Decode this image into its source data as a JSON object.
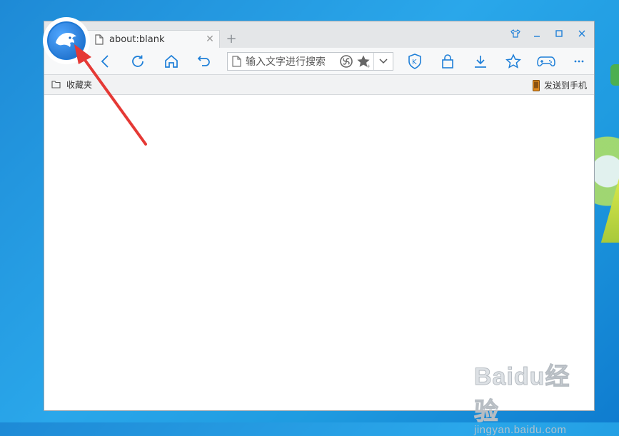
{
  "tab": {
    "title": "about:blank"
  },
  "address_bar": {
    "placeholder": "输入文字进行搜索"
  },
  "bookmarks_bar": {
    "favorites_label": "收藏夹",
    "send_to_phone_label": "发送到手机"
  },
  "watermark": {
    "main": "Baidu经验",
    "sub": "jingyan.baidu.com"
  },
  "colors": {
    "accent": "#1e7fd8",
    "annotation_arrow": "#e53935",
    "desktop_blue": "#2aa7ea"
  },
  "icons": {
    "toolbar": [
      "back-icon",
      "refresh-icon",
      "home-icon",
      "undo-icon",
      "shield-k-icon",
      "lock-icon",
      "download-icon",
      "star-icon",
      "gamepad-icon",
      "more-icon"
    ],
    "window": [
      "skin-icon",
      "minimize-icon",
      "maximize-icon",
      "close-icon"
    ]
  }
}
